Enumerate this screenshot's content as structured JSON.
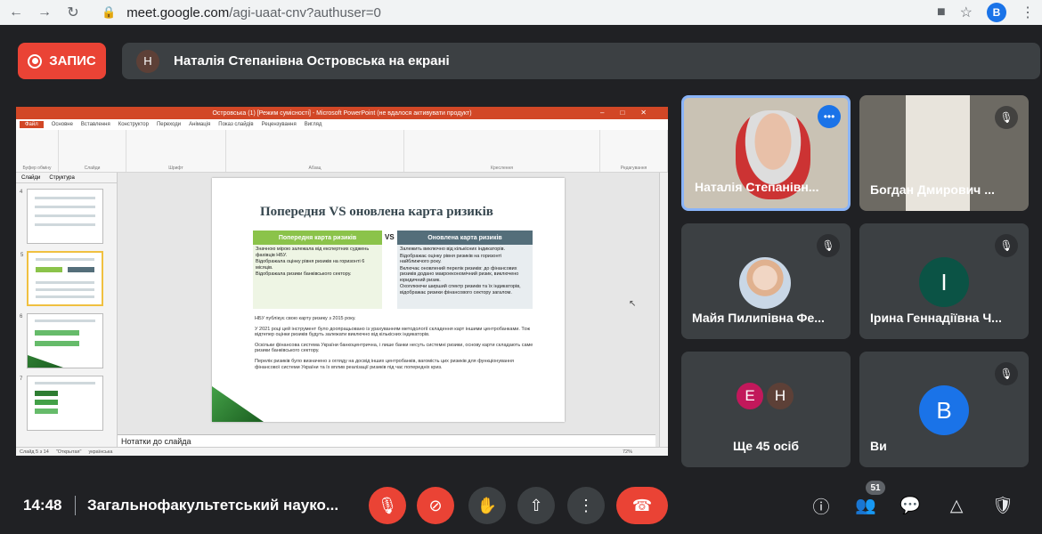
{
  "browser": {
    "url_host": "meet.google.com",
    "url_path": "/agi-uaat-cnv?authuser=0",
    "profile_initial": "B"
  },
  "record": {
    "label": "ЗАПИС"
  },
  "presenting": {
    "avatar_initial": "Н",
    "text": "Наталія Степанівна Островська на екрані"
  },
  "ppt": {
    "title": "Островська (1) [Режим сумісності] - Microsoft PowerPoint (не вдалося активувати продукт)",
    "tabs": [
      "Файл",
      "Основне",
      "Вставлення",
      "Конструктор",
      "Переходи",
      "Анімація",
      "Показ слайдів",
      "Рецензування",
      "Вигляд"
    ],
    "groups": [
      "Буфер обміну",
      "Слайди",
      "Шрифт",
      "Абзац",
      "Креслення",
      "Редагування"
    ],
    "thumb_tabs": [
      "Слайди",
      "Структура"
    ],
    "thumb_numbers": [
      "4",
      "5",
      "6",
      "7"
    ],
    "status": [
      "Слайд 5 з 14",
      "\"Открытая\"",
      "українська"
    ],
    "zoom": "72%",
    "notes_placeholder": "Нотатки до слайда",
    "slide": {
      "title": "Попередня VS оновлена карта ризиків",
      "vs": "VS",
      "left_header": "Попередня карта ризиків",
      "right_header": "Оновлена карта ризиків",
      "left_items": [
        "Значною мірою залежала від експертних суджень фахівців НБУ.",
        "Відображала оцінку рівня ризиків на горизонті 6 місяців.",
        "Відображала ризики банківського сектору."
      ],
      "right_items": [
        "Залежить виключно від кількісних індикаторів.",
        "Відображає оцінку рівня ризиків на горизонті найближчого року.",
        "Включає оновлений перелік ризиків: до фінансових ризиків додано макроекономічний ризик, виключено юридичний ризик.",
        "Охоплюючи ширший спектр ризиків та їх індикаторів, відображає ризики фінансового сектору загалом."
      ],
      "bullets": [
        "НБУ публікує свою карту ризику з 2015 року.",
        "У 2021 році цей інструмент було доопрацьовано із урахуванням методології складення карт іншими центробанками. Тож відтепер оцінки ризиків будуть залежати виключно від кількісних індикаторів.",
        "Оскільки фінансова система України банкоцентрична, і лише банки несуть системні ризики, основу карти складають саме ризики банківського сектору.",
        "Перелік ризиків було визначено з огляду на досвід інших центробанків, вагомість цих ризиків для функціонування фінансової системи України та їх вплив реалізації ризиків під час попередніх криз."
      ]
    }
  },
  "participants": [
    {
      "name": "Наталія Степанівн...",
      "type": "video"
    },
    {
      "name": "Богдан Дмирович ...",
      "type": "video"
    },
    {
      "name": "Майя Пилипівна Фе...",
      "type": "photo"
    },
    {
      "name": "Ірина Геннадіївна Ч...",
      "initial": "І",
      "color": "#0b5345"
    },
    {
      "name": "Ще 45 осіб",
      "initials": [
        "Е",
        "Н"
      ]
    },
    {
      "name": "Ви",
      "initial": "B",
      "color": "#1a73e8"
    }
  ],
  "bottom": {
    "time": "14:48",
    "meeting_name": "Загальнофакультетський науко...",
    "people_count": "51"
  },
  "colors": {
    "accent_red": "#ea4335",
    "tile_bg": "#3c4043",
    "ppt_orange": "#d24726",
    "slide_green": "#8bc34a",
    "slide_slate": "#546e7a"
  }
}
